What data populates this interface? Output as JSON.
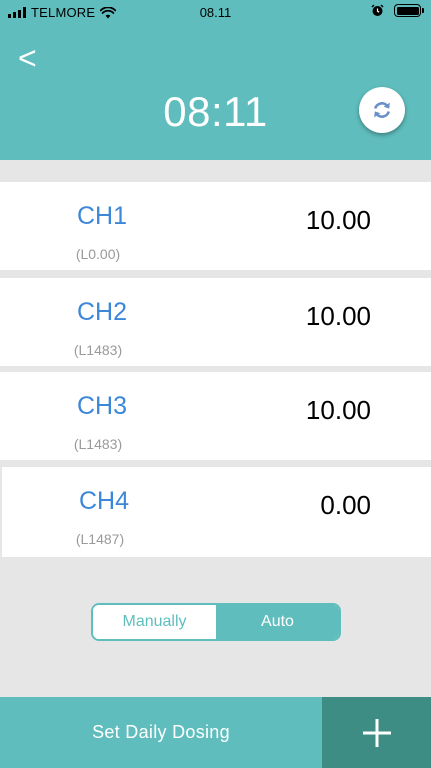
{
  "status_bar": {
    "carrier": "TELMORE",
    "time": "08.11"
  },
  "header": {
    "back_label": "<",
    "clock": "08:11",
    "refresh_icon": "refresh-icon"
  },
  "channels": [
    {
      "name": "CH1",
      "sub": "(L0.00)",
      "value": "10.00"
    },
    {
      "name": "CH2",
      "sub": "(L1483)",
      "value": "10.00"
    },
    {
      "name": "CH3",
      "sub": "(L1483)",
      "value": "10.00"
    },
    {
      "name": "CH4",
      "sub": "(L1487)",
      "value": "0.00"
    }
  ],
  "mode_toggle": {
    "options": [
      "Manually",
      "Auto"
    ],
    "selected": "Auto"
  },
  "bottom_bar": {
    "set_dosing_label": "Set Daily Dosing",
    "add_icon": "plus-icon"
  },
  "colors": {
    "teal": "#5fbebd",
    "dark_teal": "#3e8d85",
    "channel_blue": "#3d87d8"
  }
}
